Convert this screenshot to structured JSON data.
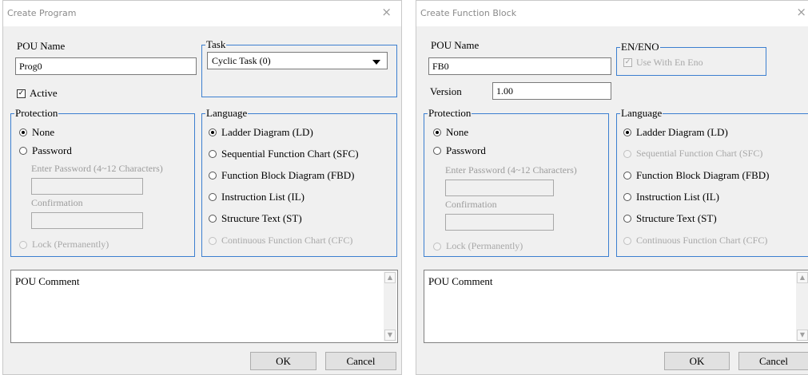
{
  "left_dialog": {
    "title": "Create Program",
    "close_glyph": "×",
    "pou_name_label": "POU Name",
    "pou_name_value": "Prog0",
    "active_label": "Active",
    "active_checked": true,
    "task": {
      "title": "Task",
      "selected": "Cyclic Task (0)"
    },
    "protection": {
      "title": "Protection",
      "none_label": "None",
      "password_label": "Password",
      "enter_password_label": "Enter Password (4~12 Characters)",
      "confirmation_label": "Confirmation",
      "lock_label": "Lock (Permanently)",
      "selected": "None"
    },
    "language": {
      "title": "Language",
      "options": [
        {
          "label": "Ladder Diagram (LD)",
          "selected": true,
          "enabled": true
        },
        {
          "label": "Sequential Function Chart (SFC)",
          "selected": false,
          "enabled": true
        },
        {
          "label": "Function Block Diagram (FBD)",
          "selected": false,
          "enabled": true
        },
        {
          "label": "Instruction List (IL)",
          "selected": false,
          "enabled": true
        },
        {
          "label": "Structure Text (ST)",
          "selected": false,
          "enabled": true
        },
        {
          "label": "Continuous Function Chart (CFC)",
          "selected": false,
          "enabled": false
        }
      ]
    },
    "comment_label": "POU Comment",
    "ok_label": "OK",
    "cancel_label": "Cancel"
  },
  "right_dialog": {
    "title": "Create Function Block",
    "close_glyph": "×",
    "pou_name_label": "POU Name",
    "pou_name_value": "FB0",
    "version_label": "Version",
    "version_value": "1.00",
    "en_eno": {
      "title": "EN/ENO",
      "use_label": "Use With En Eno",
      "checked": true,
      "enabled": false
    },
    "protection": {
      "title": "Protection",
      "none_label": "None",
      "password_label": "Password",
      "enter_password_label": "Enter Password (4~12 Characters)",
      "confirmation_label": "Confirmation",
      "lock_label": "Lock (Permanently)",
      "selected": "None"
    },
    "language": {
      "title": "Language",
      "options": [
        {
          "label": "Ladder Diagram (LD)",
          "selected": true,
          "enabled": true
        },
        {
          "label": "Sequential Function Chart (SFC)",
          "selected": false,
          "enabled": false
        },
        {
          "label": "Function Block Diagram (FBD)",
          "selected": false,
          "enabled": true
        },
        {
          "label": "Instruction List (IL)",
          "selected": false,
          "enabled": true
        },
        {
          "label": "Structure Text (ST)",
          "selected": false,
          "enabled": true
        },
        {
          "label": "Continuous Function Chart (CFC)",
          "selected": false,
          "enabled": false
        }
      ]
    },
    "comment_label": "POU Comment",
    "ok_label": "OK",
    "cancel_label": "Cancel"
  },
  "icons": {
    "checkmark": "✓",
    "scroll_up": "▲",
    "scroll_down": "▼"
  }
}
